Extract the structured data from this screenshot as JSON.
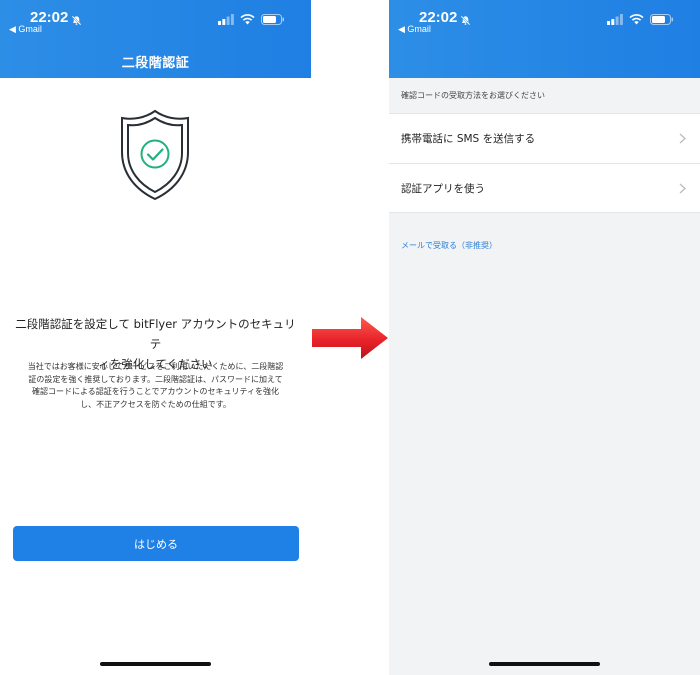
{
  "status_bar": {
    "time": "22:02",
    "back_app": "◀ Gmail"
  },
  "screen_1": {
    "title": "二段階認証",
    "heading_line1": "二段階認証を設定して bitFlyer アカウントのセキュリテ",
    "heading_line2": "ィを強化してください",
    "description_lines": [
      "当社ではお客様に安心してサービスをご利用いただくために、二段階認",
      "証の設定を強く推奨しております。二段階認証は、パスワードに加えて",
      "確認コードによる認証を行うことでアカウントのセキュリティを強化",
      "し、不正アクセスを防ぐための仕組です。"
    ],
    "start_button": "はじめる"
  },
  "screen_2": {
    "section_label": "確認コードの受取方法をお選びください",
    "options": [
      {
        "label": "携帯電話に SMS を送信する"
      },
      {
        "label": "認証アプリを使う"
      }
    ],
    "email_link": "メールで受取る（非推奨）"
  },
  "colors": {
    "header_blue": "#1f7fe3",
    "button_blue": "#1f80e6",
    "link_blue": "#2a7fd6",
    "shield_check_green": "#22b07d",
    "arrow_red": "#e8232a"
  },
  "icons": [
    "bell-off-icon",
    "signal-icon",
    "wifi-icon",
    "battery-icon",
    "shield-check-icon",
    "chevron-right-icon",
    "arrow-right-icon"
  ]
}
